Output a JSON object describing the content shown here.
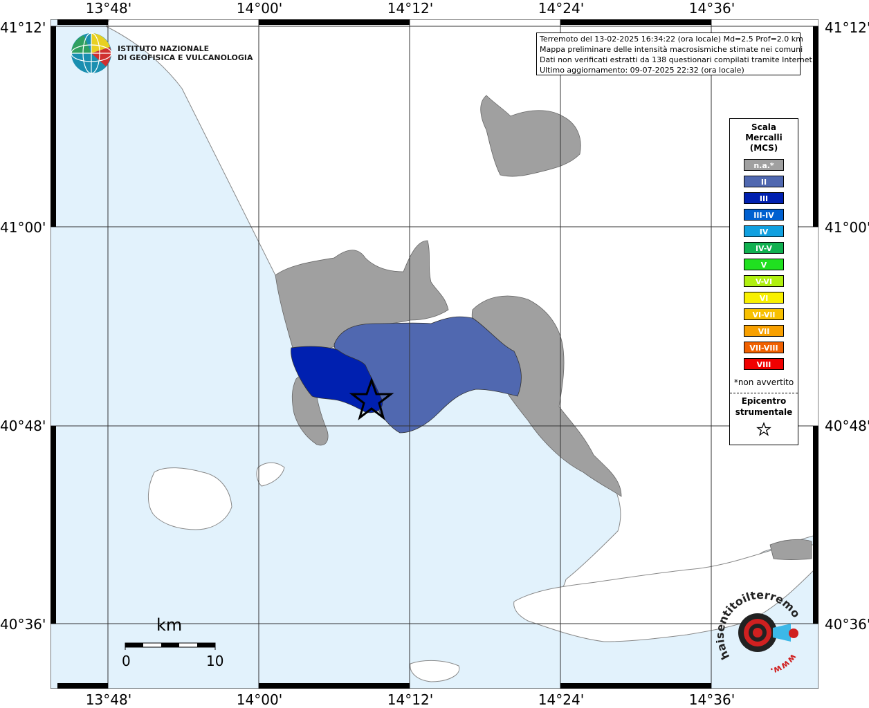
{
  "map": {
    "lon_ticks": [
      "13°48'",
      "14°00'",
      "14°12'",
      "14°24'",
      "14°36'"
    ],
    "lat_ticks": [
      "41°12'",
      "41°00'",
      "40°48'",
      "40°36'"
    ]
  },
  "header": {
    "line1": "Terremoto del 13-02-2025 16:34:22 (ora locale) Md=2.5 Prof=2.0 km",
    "line2": "Mappa preliminare delle intensità macrosismiche stimate nei comuni",
    "line3": "Dati non verificati estratti da 138 questionari compilati tramite Internet.",
    "line4": "Ultimo aggiornamento: 09-07-2025 22:32 (ora locale)"
  },
  "logo": {
    "line1": "ISTITUTO NAZIONALE",
    "line2": "DI GEOFISICA E VULCANOLOGIA"
  },
  "legend": {
    "title1": "Scala",
    "title2": "Mercalli",
    "title3": "(MCS)",
    "items": [
      {
        "label": "n.a.*",
        "color": "#a0a0a0"
      },
      {
        "label": "II",
        "color": "#5068b0"
      },
      {
        "label": "III",
        "color": "#0020b0"
      },
      {
        "label": "III-IV",
        "color": "#0060d0"
      },
      {
        "label": "IV",
        "color": "#10a0e0"
      },
      {
        "label": "IV-V",
        "color": "#10b050"
      },
      {
        "label": "V",
        "color": "#20e020"
      },
      {
        "label": "V-VI",
        "color": "#b0f010"
      },
      {
        "label": "VI",
        "color": "#f8f000"
      },
      {
        "label": "VI-VII",
        "color": "#f8c000"
      },
      {
        "label": "VII",
        "color": "#f8a000"
      },
      {
        "label": "VII-VIII",
        "color": "#f06000"
      },
      {
        "label": "VIII",
        "color": "#f00000"
      }
    ],
    "note": "*non avvertito",
    "epicentre1": "Epicentro",
    "epicentre2": "strumentale"
  },
  "scale_bar": {
    "unit": "km",
    "min": "0",
    "max": "10"
  },
  "site_logo": {
    "text": "haisentitoilterremoto.it",
    "www": "www."
  },
  "colors": {
    "sea": "#e2f2fc",
    "land": "#ffffff",
    "na": "#a0a0a0",
    "ii": "#5068b0",
    "iii": "#0020b0"
  }
}
